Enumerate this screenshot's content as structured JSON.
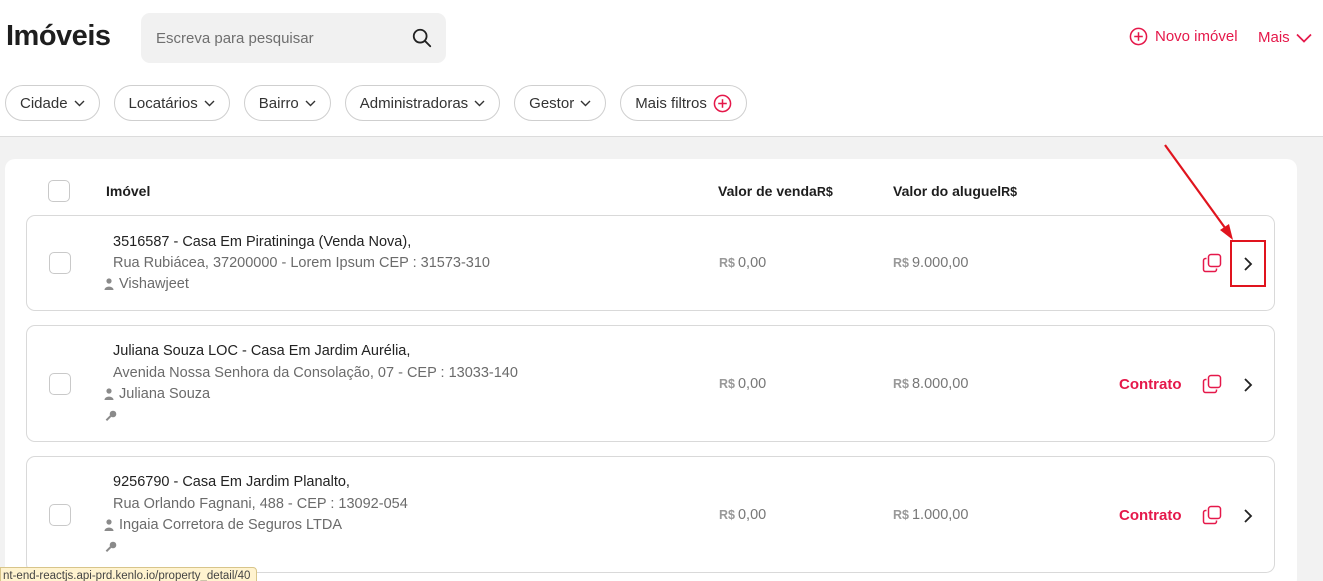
{
  "header": {
    "title": "Imóveis",
    "search_placeholder": "Escreva para pesquisar",
    "new_property_label": "Novo imóvel",
    "more_label": "Mais"
  },
  "filters": [
    "Cidade",
    "Locatários",
    "Bairro",
    "Administradoras",
    "Gestor",
    "Mais filtros"
  ],
  "table": {
    "columns": {
      "property": "Imóvel",
      "sale_value": "Valor de venda",
      "rent_value": "Valor do aluguel",
      "currency": "R$"
    },
    "rows": [
      {
        "title": "3516587 - Casa Em Piratininga (Venda Nova),",
        "address": "Rua Rubiácea, 37200000 - Lorem Ipsum CEP : 31573-310",
        "owner": "Vishawjeet",
        "has_key": false,
        "sale": "0,00",
        "rent": "9.000,00",
        "contract": ""
      },
      {
        "title": "Juliana Souza LOC - Casa Em Jardim Aurélia,",
        "address": "Avenida Nossa Senhora da Consolação, 07 - CEP : 13033-140",
        "owner": "Juliana Souza",
        "has_key": true,
        "sale": "0,00",
        "rent": "8.000,00",
        "contract": "Contrato"
      },
      {
        "title": "9256790 - Casa Em Jardim Planalto,",
        "address": "Rua Orlando Fagnani, 488 - CEP : 13092-054",
        "owner": "Ingaia Corretora de Seguros LTDA",
        "has_key": true,
        "sale": "0,00",
        "rent": "1.000,00",
        "contract": "Contrato"
      }
    ]
  },
  "status_url": "nt-end-reactjs.api-prd.kenlo.io/property_detail/40",
  "colors": {
    "accent": "#e5184a",
    "annotation": "#e0141e"
  }
}
